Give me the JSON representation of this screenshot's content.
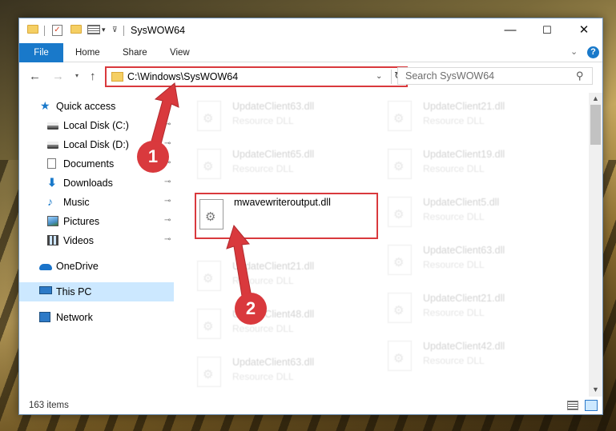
{
  "window": {
    "title": "SysWOW64",
    "minimize_glyph": "—",
    "maximize_glyph": "☐",
    "close_glyph": "✕"
  },
  "ribbon": {
    "file": "File",
    "home": "Home",
    "share": "Share",
    "view": "View",
    "collapse_glyph": "⌄",
    "help_glyph": "?"
  },
  "nav": {
    "back_glyph": "←",
    "forward_glyph": "→",
    "recent_glyph": "▾",
    "up_glyph": "↑"
  },
  "address": {
    "path": "C:\\Windows\\SysWOW64",
    "dropdown_glyph": "⌄",
    "refresh_glyph": "↻"
  },
  "search": {
    "placeholder": "Search SysWOW64",
    "icon": "search-icon"
  },
  "sidebar": {
    "items": [
      {
        "label": "Quick access",
        "icon": "star-icon"
      },
      {
        "label": "Local Disk (C:)",
        "icon": "drive-icon",
        "pinned": true
      },
      {
        "label": "Local Disk (D:)",
        "icon": "drive-icon",
        "pinned": true
      },
      {
        "label": "Documents",
        "icon": "document-icon",
        "pinned": true
      },
      {
        "label": "Downloads",
        "icon": "download-icon",
        "pinned": true
      },
      {
        "label": "Music",
        "icon": "music-icon",
        "pinned": true
      },
      {
        "label": "Pictures",
        "icon": "pictures-icon",
        "pinned": true
      },
      {
        "label": "Videos",
        "icon": "videos-icon",
        "pinned": true
      },
      {
        "label": "OneDrive",
        "icon": "cloud-icon"
      },
      {
        "label": "This PC",
        "icon": "computer-icon",
        "selected": true
      },
      {
        "label": "Network",
        "icon": "network-icon"
      }
    ],
    "pin_glyph": "📌"
  },
  "files": {
    "left": [
      {
        "name": "UpdateClient63.dll",
        "type": "Resource DLL"
      },
      {
        "name": "UpdateClient65.dll",
        "type": "Resource DLL"
      },
      {
        "name": "mwavewriteroutput.dll",
        "type": ""
      },
      {
        "name": "UpdateClient21.dll",
        "type": "Resource DLL"
      },
      {
        "name": "UpdateClient48.dll",
        "type": "Resource DLL"
      },
      {
        "name": "UpdateClient63.dll",
        "type": "Resource DLL"
      }
    ],
    "right": [
      {
        "name": "UpdateClient21.dll",
        "type": "Resource DLL"
      },
      {
        "name": "UpdateClient19.dll",
        "type": "Resource DLL"
      },
      {
        "name": "UpdateClient5.dll",
        "type": "Resource DLL"
      },
      {
        "name": "UpdateClient63.dll",
        "type": "Resource DLL"
      },
      {
        "name": "UpdateClient21.dll",
        "type": "Resource DLL"
      },
      {
        "name": "UpdateClient42.dll",
        "type": "Resource DLL"
      }
    ]
  },
  "status": {
    "item_count": "163 items"
  },
  "annotations": {
    "step1": "1",
    "step2": "2",
    "accent_color": "#d9393d"
  },
  "colors": {
    "file_tab": "#1979ca",
    "selection": "#cce8ff"
  }
}
